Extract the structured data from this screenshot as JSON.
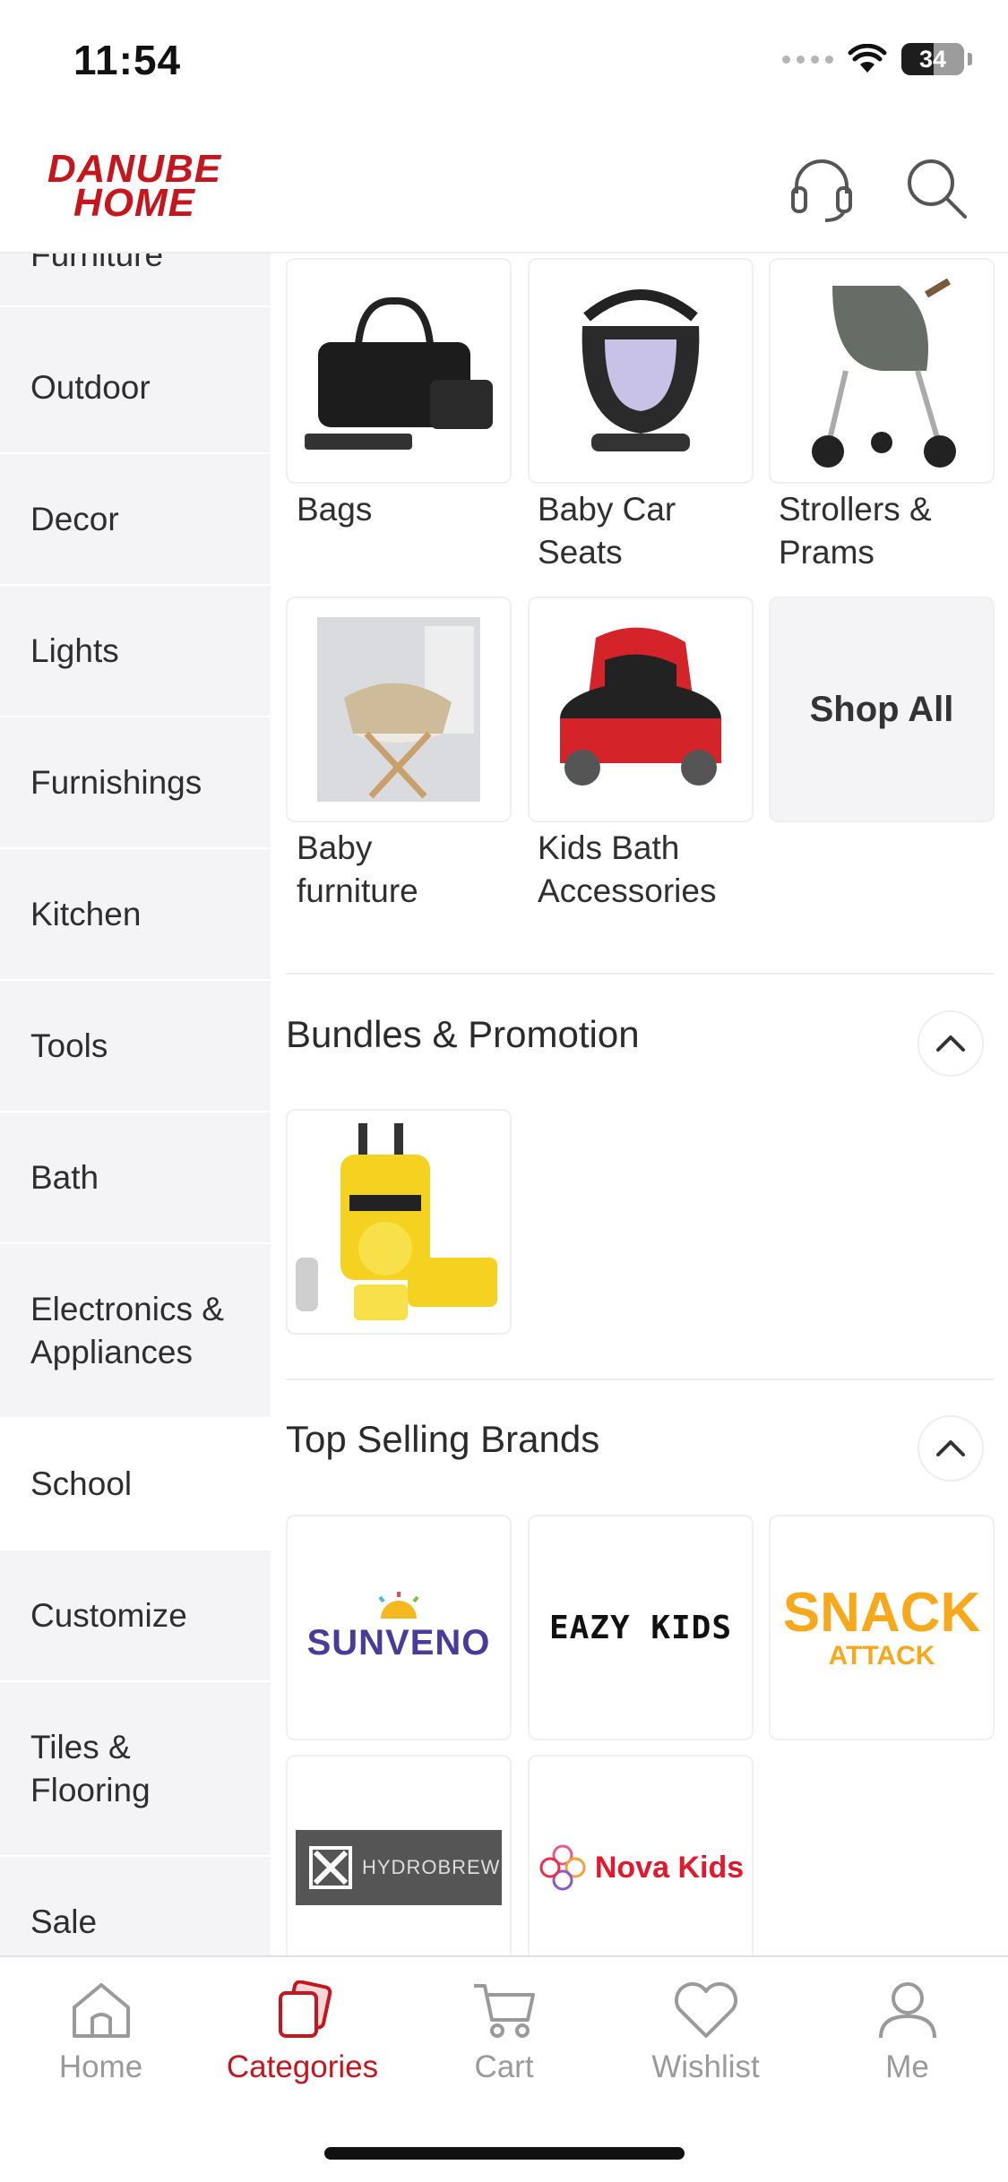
{
  "status_bar": {
    "time": "11:54",
    "battery": "34"
  },
  "header": {
    "brand_line1": "DANUBE",
    "brand_line2": "HOME"
  },
  "sidebar": {
    "items": [
      {
        "label": "Furniture"
      },
      {
        "label": "Outdoor"
      },
      {
        "label": "Decor"
      },
      {
        "label": "Lights"
      },
      {
        "label": "Furnishings"
      },
      {
        "label": "Kitchen"
      },
      {
        "label": "Tools"
      },
      {
        "label": "Bath"
      },
      {
        "label": "Electronics & Appliances"
      },
      {
        "label": "School"
      },
      {
        "label": "Customize"
      },
      {
        "label": "Tiles & Flooring"
      },
      {
        "label": "Sale"
      }
    ],
    "active": "School"
  },
  "categories": {
    "tiles": [
      {
        "label": "Bags"
      },
      {
        "label": "Baby Car Seats"
      },
      {
        "label": "Strollers & Prams"
      },
      {
        "label": "Baby furniture"
      },
      {
        "label": "Kids Bath Accessories"
      }
    ],
    "shop_all": "Shop All"
  },
  "bundles": {
    "title": "Bundles & Promotion"
  },
  "brands": {
    "title": "Top Selling Brands",
    "items": [
      {
        "name": "SUNVENO"
      },
      {
        "name": "EAZY KIDS"
      },
      {
        "name": "SNACK",
        "sub": "ATTACK"
      },
      {
        "name": "HYDROBREW"
      },
      {
        "name": "Nova Kids"
      }
    ]
  },
  "tabbar": {
    "tabs": [
      {
        "label": "Home",
        "icon": "home-icon"
      },
      {
        "label": "Categories",
        "icon": "categories-icon"
      },
      {
        "label": "Cart",
        "icon": "cart-icon"
      },
      {
        "label": "Wishlist",
        "icon": "heart-icon"
      },
      {
        "label": "Me",
        "icon": "user-icon"
      }
    ],
    "active": "Categories"
  },
  "colors": {
    "brand": "#c5161d",
    "sidebar_bg": "#f4f4f6",
    "inactive_tab": "#9a9a9a"
  }
}
